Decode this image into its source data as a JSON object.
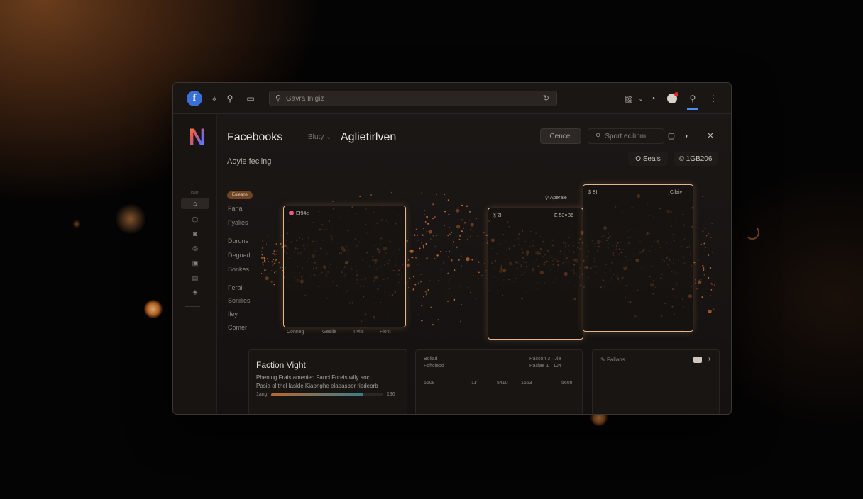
{
  "app": {
    "search_placeholder": "Gavra Inigiz",
    "title": "Facebooks",
    "breadcrumb": "Bluty ⌄",
    "page_title": "Aglietirlven",
    "subtitle": "Aoyle feciing"
  },
  "header": {
    "cancel_label": "Cencel",
    "search_label": "Sport ecilinm",
    "pill_seals": "O Seals",
    "pill_count": "© 1GB206"
  },
  "sidebar": {
    "small_label": "iouie",
    "badge": "Eoieane",
    "nav_items": [
      "Fanai",
      "Fyalies",
      "Dorons",
      "Degoad",
      "Sonkes",
      "Feral",
      "Sonilies",
      "Iley",
      "Comer"
    ]
  },
  "plot": {
    "card1_label": "Ef94e",
    "card2_label": "§ 2I",
    "card2_right": "E 53×B6",
    "card3_label": "$ BI",
    "card3_right": "Cilaiv",
    "floating_label": "Aperaie",
    "x_labels": [
      "Conneg",
      "Gealie",
      "Tiviis",
      "Fiont"
    ]
  },
  "panel_left": {
    "title": "Faction Vight",
    "line1": "Pheniug Frais amenied Fanci Foreis wlfy aoc",
    "line2": "Pasia ol thel laslde Kiaonghe elaeasber riedeorb",
    "start": "1ang",
    "end": "196",
    "progress": 0.82
  },
  "panel_mid": {
    "label1": "Bollad",
    "label2": "Fdftcieod",
    "right1": "Paccon 3 · Jie",
    "right2": "Paciae 1 · 1J4",
    "values": [
      "5608",
      "11'",
      "5410",
      "1663",
      "5608"
    ]
  },
  "panel_right": {
    "label": "Fallans"
  },
  "colors": {
    "accent": "#e3b78c",
    "particle": "#e07a3a",
    "badge": "#6e4425",
    "link": "#4f8cf7"
  }
}
